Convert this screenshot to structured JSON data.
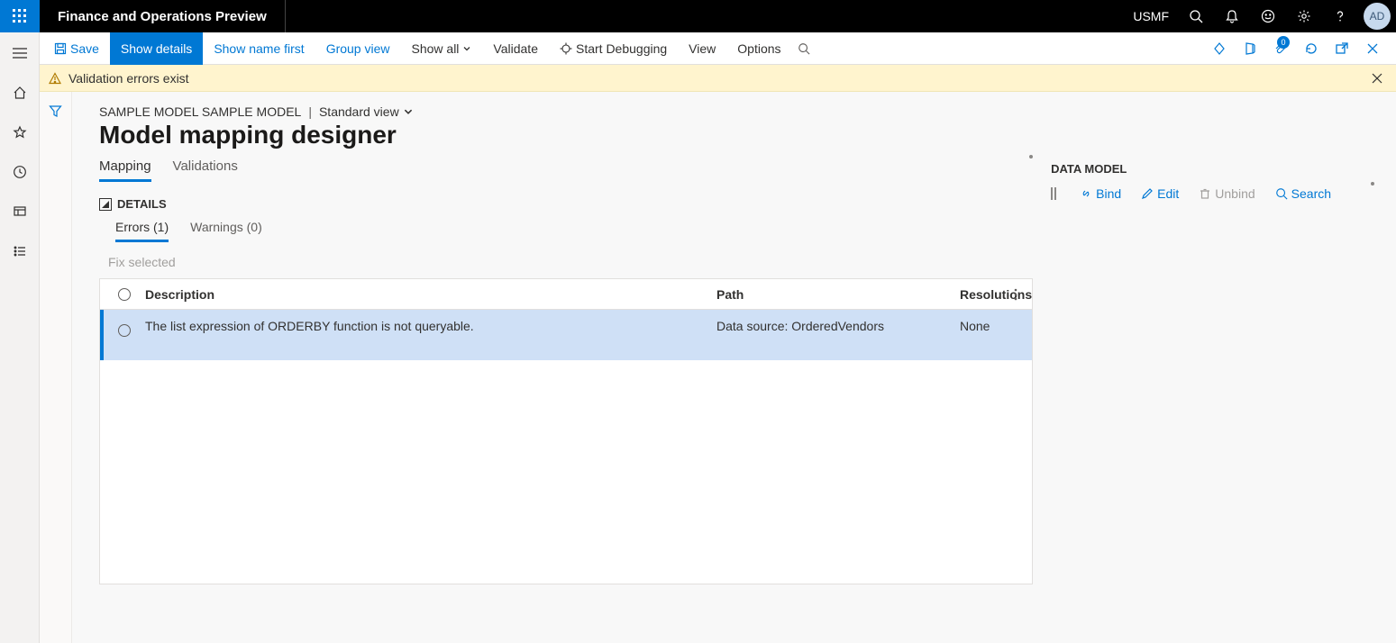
{
  "titlebar": {
    "app_title": "Finance and Operations Preview",
    "company": "USMF",
    "avatar": "AD"
  },
  "commandbar": {
    "save": "Save",
    "show_details": "Show details",
    "show_name_first": "Show name first",
    "group_view": "Group view",
    "show_all": "Show all",
    "validate": "Validate",
    "start_debugging": "Start Debugging",
    "view": "View",
    "options": "Options",
    "badge": "0"
  },
  "banner": {
    "text": "Validation errors exist"
  },
  "breadcrumb": {
    "trail": "SAMPLE MODEL SAMPLE MODEL",
    "sep": "|",
    "view_label": "Standard view"
  },
  "page_title": "Model mapping designer",
  "maintabs": {
    "mapping": "Mapping",
    "validations": "Validations"
  },
  "details_label": "DETAILS",
  "subtabs": {
    "errors": "Errors (1)",
    "warnings": "Warnings (0)"
  },
  "fix_selected": "Fix selected",
  "grid": {
    "col_description": "Description",
    "col_path": "Path",
    "col_resolutions": "Resolutions",
    "rows": [
      {
        "description": "The list expression of ORDERBY function is not queryable.",
        "path": "Data source: OrderedVendors",
        "resolutions": "None"
      }
    ]
  },
  "datamodel": {
    "title": "DATA MODEL",
    "bind": "Bind",
    "edit": "Edit",
    "unbind": "Unbind",
    "search": "Search"
  }
}
